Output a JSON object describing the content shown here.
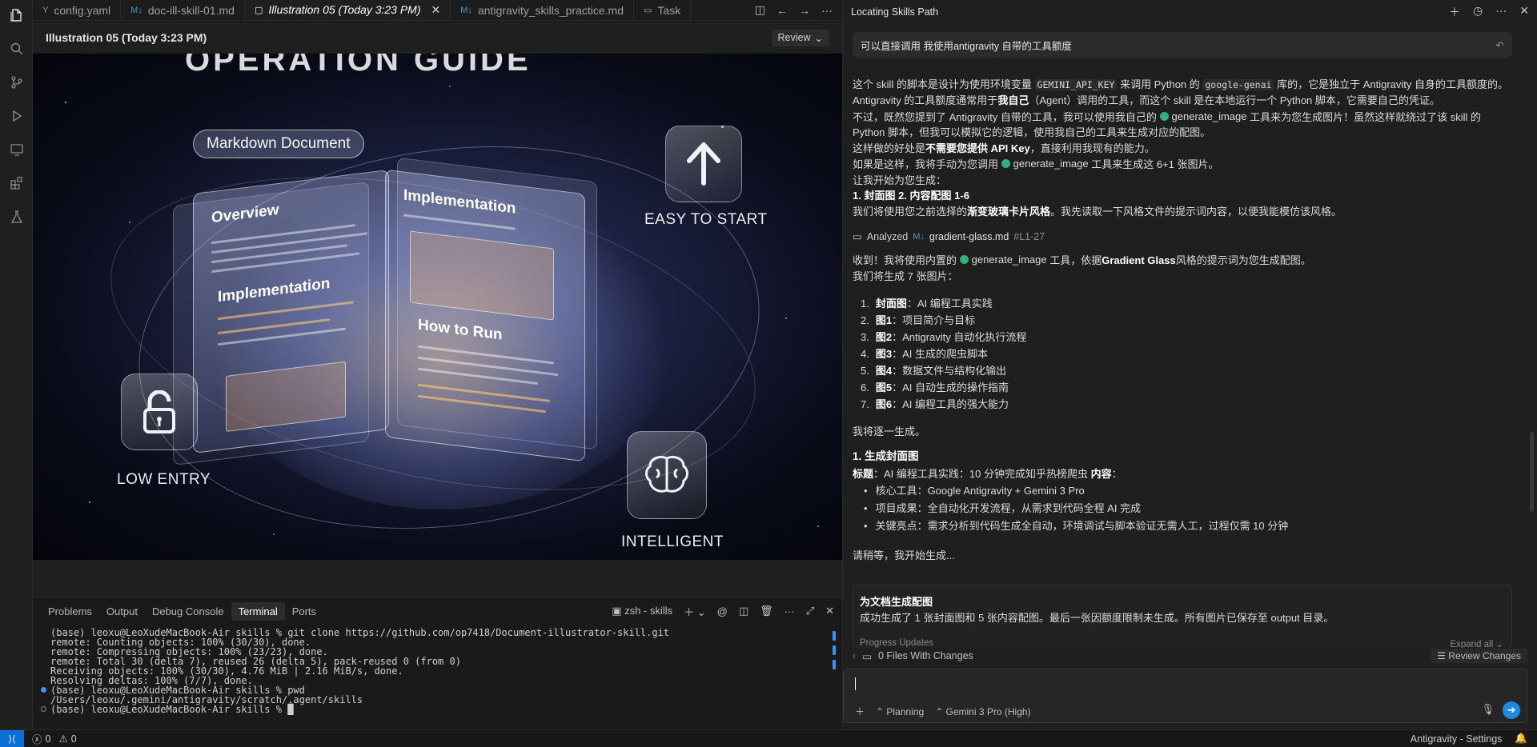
{
  "tabs": [
    {
      "icon": "Y",
      "label": "config.yaml"
    },
    {
      "icon": "M↓",
      "label": "doc-ill-skill-01.md"
    },
    {
      "icon": "▢",
      "label": "Illustration 05 (Today 3:23 PM)",
      "active": true
    },
    {
      "icon": "M↓",
      "label": "antigravity_skills_practice.md"
    },
    {
      "icon": "▭",
      "label": "Task"
    }
  ],
  "editor": {
    "title": "Illustration 05 (Today 3:23 PM)",
    "review_label": "Review"
  },
  "image": {
    "banner": "OPERATION GUIDE",
    "pill": "Markdown Document",
    "page_left_title_1": "Overview",
    "page_left_title_2": "Implementation",
    "page_right_title_1": "Implementation",
    "page_right_title_2": "How to Run",
    "label_easy": "EASY TO START",
    "label_low": "LOW ENTRY",
    "label_intelligent": "INTELLIGENT"
  },
  "panel": {
    "tabs": [
      "Problems",
      "Output",
      "Debug Console",
      "Terminal",
      "Ports"
    ],
    "active_tab": "Terminal",
    "shell": "zsh - skills",
    "lines": [
      {
        "dot": "",
        "text": "(base) leoxu@LeoXudeMacBook-Air skills % git clone https://github.com/op7418/Document-illustrator-skill.git"
      },
      {
        "dot": "",
        "text": "remote: Counting objects: 100% (30/30), done."
      },
      {
        "dot": "",
        "text": "remote: Compressing objects: 100% (23/23), done."
      },
      {
        "dot": "",
        "text": "remote: Total 30 (delta 7), reused 26 (delta 5), pack-reused 0 (from 0)"
      },
      {
        "dot": "",
        "text": "Receiving objects: 100% (30/30), 4.76 MiB | 2.16 MiB/s, done."
      },
      {
        "dot": "",
        "text": "Resolving deltas: 100% (7/7), done."
      },
      {
        "dot": "blue",
        "text": "(base) leoxu@LeoXudeMacBook-Air skills % pwd"
      },
      {
        "dot": "",
        "text": "/Users/leoxu/.gemini/antigravity/scratch/.agent/skills"
      },
      {
        "dot": "hollow",
        "text": "(base) leoxu@LeoXudeMacBook-Air skills % █"
      }
    ]
  },
  "chat": {
    "header_title": "Locating Skills Path",
    "user_message": "可以直接调用 我使用antigravity 自带的工具额度",
    "p1_a": "这个 skill 的脚本是设计为使用环境变量 ",
    "p1_code1": "GEMINI_API_KEY",
    "p1_b": " 来调用 Python 的 ",
    "p1_code2": "google-genai",
    "p1_c": " 库的，它是独立于 Antigravity 自身的工具额度的。",
    "p2_a": "Antigravity 的工具额度通常用于",
    "p2_bold": "我自己",
    "p2_b": "（Agent）调用的工具，而这个 skill 是在本地运行一个 Python 脚本，它需要自己的凭证。",
    "p3_a": "不过，既然您提到了 Antigravity 自带的工具，我可以使用我自己的 ",
    "tool_name": "generate_image",
    "p3_b": " 工具来为您生成图片！虽然这样就绕过了该 skill 的",
    "p3_c": "Python 脚本，但我可以模拟它的逻辑，使用我自己的工具来生成对应的配图。",
    "p4_a": "这样做的好处是",
    "p4_bold": "不需要您提供 API Key",
    "p4_b": "，直接利用我现有的能力。",
    "p5_a": "如果是这样，我将手动为您调用 ",
    "p5_b": " 工具来生成这 6+1 张图片。",
    "p6": "让我开始为您生成：",
    "p7_bold": "1. 封面图 2. 内容配图 1-6",
    "p8_a": "我们将使用您之前选择的",
    "p8_bold": "渐变玻璃卡片风格",
    "p8_b": "。我先读取一下风格文件的提示词内容，以便我能模仿该风格。",
    "analyzed_label": "Analyzed",
    "analyzed_file": "gradient-glass.md",
    "analyzed_range": "#L1-27",
    "p9_a": "收到！我将使用内置的 ",
    "p9_b": " 工具，依据",
    "p9_bold": "Gradient Glass",
    "p9_c": "风格的提示词为您生成配图。",
    "p10": "我们将生成 7 张图片：",
    "list": [
      {
        "n": "1.",
        "bold": "封面图",
        "text": "：AI 编程工具实践"
      },
      {
        "n": "2.",
        "bold": "图1",
        "text": "：项目简介与目标"
      },
      {
        "n": "3.",
        "bold": "图2",
        "text": "：Antigravity 自动化执行流程"
      },
      {
        "n": "4.",
        "bold": "图3",
        "text": "：AI 生成的爬虫脚本"
      },
      {
        "n": "5.",
        "bold": "图4",
        "text": "：数据文件与结构化输出"
      },
      {
        "n": "6.",
        "bold": "图5",
        "text": "：AI 自动生成的操作指南"
      },
      {
        "n": "7.",
        "bold": "图6",
        "text": "：AI 编程工具的强大能力"
      }
    ],
    "p11": "我将逐一生成。",
    "h_cover": "1. 生成封面图",
    "cover_title_bold": "标题",
    "cover_title_text": "：AI 编程工具实践：10 分钟完成知乎热榜爬虫 ",
    "cover_content_bold": "内容",
    "cover_content_text": "：",
    "bullets": [
      "核心工具：Google Antigravity + Gemini 3 Pro",
      "项目成果：全自动化开发流程，从需求到代码全程 AI 完成",
      "关键亮点：需求分析到代码生成全自动，环境调试与脚本验证无需人工，过程仅需 10 分钟"
    ],
    "p12": "请稍等，我开始生成...",
    "card_title": "为文档生成配图",
    "card_text": "成功生成了 1 张封面图和 5 张内容配图。最后一张因额度限制未生成。所有图片已保存至 output 目录。",
    "card_progress": "Progress Updates",
    "card_expand": "Expand all",
    "files_changes": "0 Files With Changes",
    "review_changes": "Review Changes",
    "mode": "Planning",
    "model": "Gemini 3 Pro (High)"
  },
  "status": {
    "errors": "0",
    "warnings": "0",
    "settings": "Antigravity - Settings"
  }
}
